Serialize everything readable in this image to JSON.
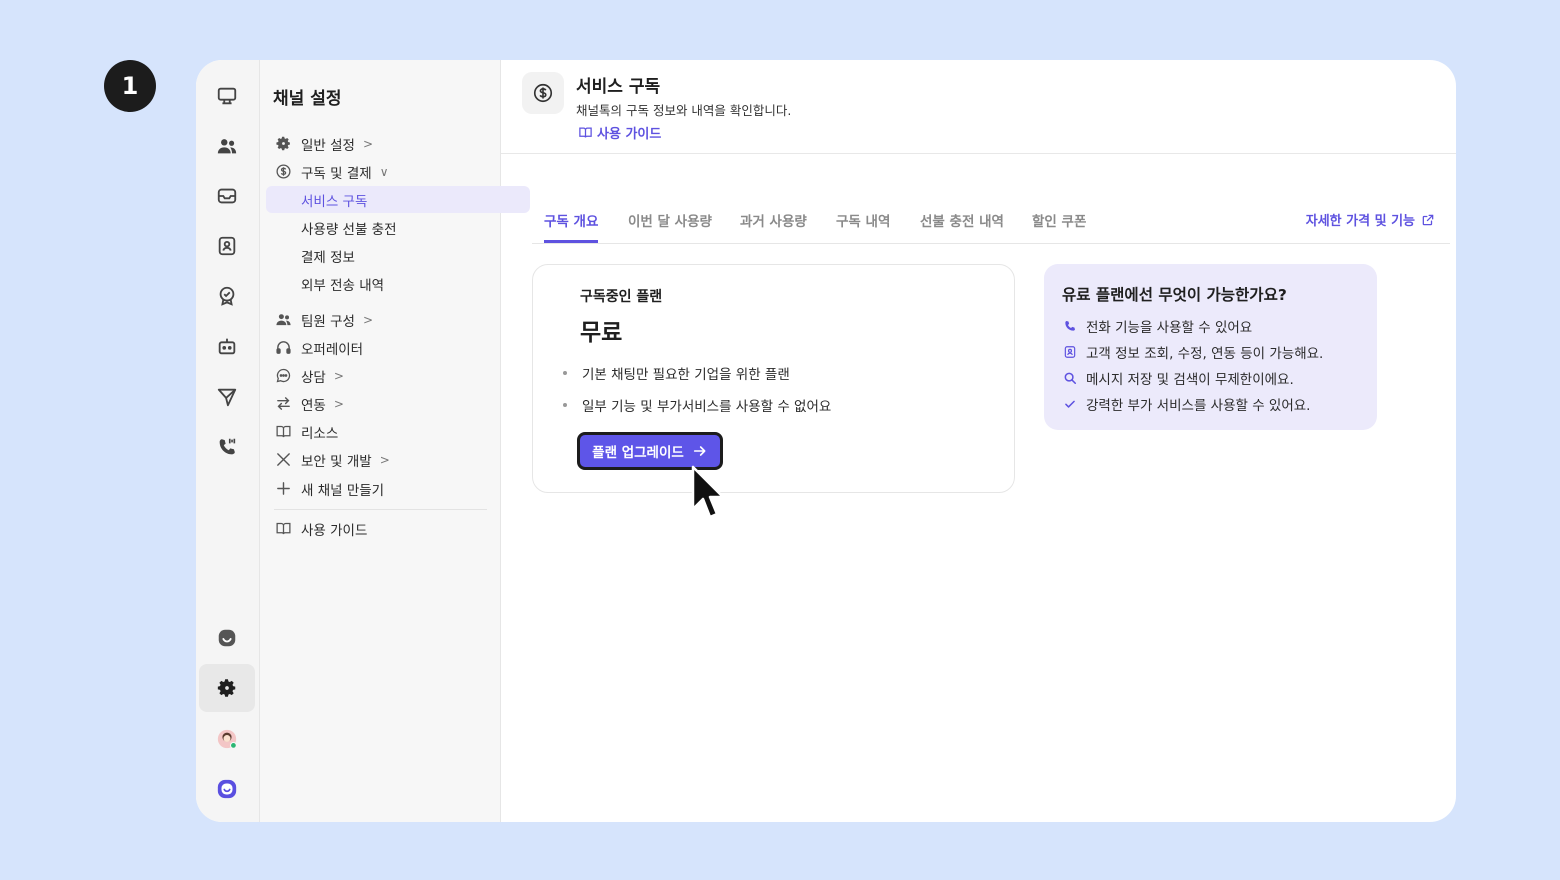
{
  "step_badge": "1",
  "rail": {
    "items": [
      {
        "icon": "monitor-icon"
      },
      {
        "icon": "users-icon"
      },
      {
        "icon": "inbox-icon"
      },
      {
        "icon": "contact-card-icon"
      },
      {
        "icon": "badge-check-icon"
      },
      {
        "icon": "bot-icon"
      },
      {
        "icon": "send-icon"
      },
      {
        "icon": "phone-icon"
      },
      {
        "icon": "chat-logo-icon"
      },
      {
        "icon": "gear-icon"
      },
      {
        "icon": "avatar"
      },
      {
        "icon": "channel-talk-logo-icon"
      }
    ]
  },
  "nav": {
    "title": "채널 설정",
    "items": [
      {
        "label": "일반 설정",
        "icon": "gear-icon",
        "chevron": ">"
      },
      {
        "label": "구독 및 결제",
        "icon": "dollar-circle-icon",
        "chevron": "∨"
      },
      {
        "label": "서비스 구독"
      },
      {
        "label": "사용량 선불 충전"
      },
      {
        "label": "결제 정보"
      },
      {
        "label": "외부 전송 내역"
      },
      {
        "label": "팀원 구성",
        "icon": "users-icon",
        "chevron": ">"
      },
      {
        "label": "오퍼레이터",
        "icon": "headset-icon"
      },
      {
        "label": "상담",
        "icon": "chat-bubble-icon",
        "chevron": ">"
      },
      {
        "label": "연동",
        "icon": "swap-arrows-icon",
        "chevron": ">"
      },
      {
        "label": "리소스",
        "icon": "book-icon"
      },
      {
        "label": "보안 및 개발",
        "icon": "tools-icon",
        "chevron": ">"
      },
      {
        "label": "새 채널 만들기",
        "icon": "plus-icon"
      },
      {
        "label": "사용 가이드",
        "icon": "book-icon"
      }
    ]
  },
  "header": {
    "icon": "dollar-circle-icon",
    "title": "서비스 구독",
    "subtitle": "채널톡의 구독 정보와 내역을 확인합니다.",
    "guide_link": "사용 가이드"
  },
  "tabs": {
    "items": [
      "구독 개요",
      "이번 달 사용량",
      "과거 사용량",
      "구독 내역",
      "선불 충전 내역",
      "할인 쿠폰"
    ],
    "active_index": 0,
    "link": "자세한 가격 및 기능"
  },
  "plan": {
    "label": "구독중인 플랜",
    "name": "무료",
    "bullets": [
      "기본 채팅만 필요한 기업을 위한 플랜",
      "일부 기능 및 부가서비스를 사용할 수 없어요"
    ],
    "upgrade_button": "플랜 업그레이드"
  },
  "promo": {
    "title": "유료 플랜에선 무엇이 가능한가요?",
    "items": [
      {
        "icon": "phone-icon",
        "text": "전화 기능을 사용할 수 있어요"
      },
      {
        "icon": "contact-card-icon",
        "text": "고객 정보 조회, 수정, 연동 등이 가능해요."
      },
      {
        "icon": "search-icon",
        "text": "메시지 저장 및 검색이 무제한이에요."
      },
      {
        "icon": "check-icon",
        "text": "강력한 부가 서비스를 사용할 수 있어요."
      }
    ]
  },
  "colors": {
    "accent": "#5e52e0",
    "background": "#d6e4fc",
    "promo_bg": "#eceafb",
    "active_nav_bg": "#ebe9fb"
  }
}
